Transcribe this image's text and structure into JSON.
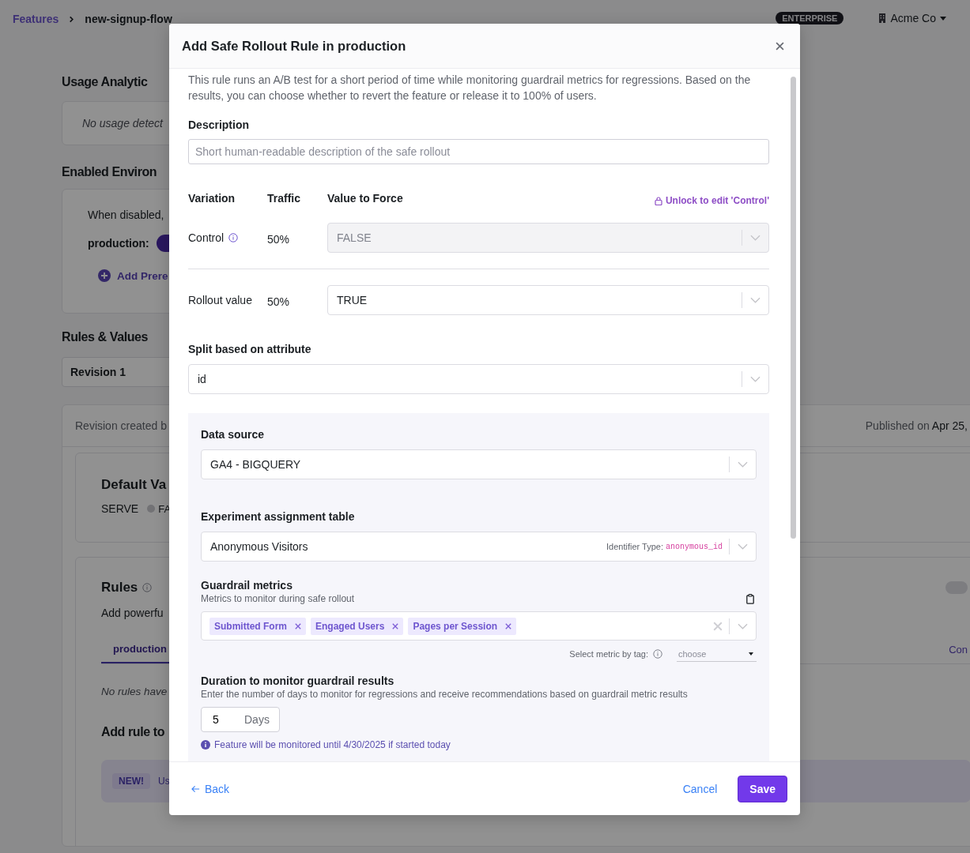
{
  "topbar": {
    "breadcrumb": [
      {
        "label": "Features",
        "kind": "link"
      },
      {
        "label": "new-signup-flow",
        "kind": "current"
      }
    ],
    "plan_badge": "ENTERPRISE",
    "org": "Acme Co"
  },
  "background": {
    "usage": {
      "title": "Usage Analytic",
      "message": "No usage detect"
    },
    "environments": {
      "title": "Enabled Environ",
      "note": "When disabled,",
      "env_label": "production:",
      "toggle_on": true,
      "add_link": "Add Prere"
    },
    "rules_values": {
      "title": "Rules & Values",
      "revision": "Revision 1",
      "created": "Revision created b",
      "published_label": "Published on",
      "published_date": "Apr 25,"
    },
    "default_value": {
      "title": "Default Va",
      "serve": "SERVE",
      "value": "FA"
    },
    "rules": {
      "title": "Rules",
      "description": "Add powerfu",
      "toggle_on": false,
      "tabs": [
        {
          "label": "production",
          "selected": true
        }
      ],
      "side_link": "Con",
      "empty": "No rules have",
      "add_title": "Add rule to",
      "banner_badge": "NEW!",
      "banner_text": "Us"
    }
  },
  "modal": {
    "title": "Add Safe Rollout Rule in production",
    "intro": "This rule runs an A/B test for a short period of time while monitoring guardrail metrics for regressions. Based on the results, you can choose whether to revert the feature or release it to 100% of users.",
    "description": {
      "label": "Description",
      "placeholder": "Short human-readable description of the safe rollout"
    },
    "variations": {
      "headers": [
        "Variation",
        "Traffic",
        "Value to Force"
      ],
      "unlock": "Unlock to edit 'Control'",
      "rows": [
        {
          "name": "Control",
          "info": true,
          "traffic": "50%",
          "value": "FALSE",
          "disabled": true
        },
        {
          "name": "Rollout value",
          "info": false,
          "traffic": "50%",
          "value": "TRUE",
          "disabled": false
        }
      ]
    },
    "split": {
      "label": "Split based on attribute",
      "value": "id"
    },
    "data_source": {
      "label": "Data source",
      "value": "GA4 - BIGQUERY"
    },
    "assignment": {
      "label": "Experiment assignment table",
      "value": "Anonymous Visitors",
      "identifier_label": "Identifier Type:",
      "identifier": "anonymous_id"
    },
    "guardrail": {
      "label": "Guardrail metrics",
      "hint": "Metrics to monitor during safe rollout",
      "tags": [
        "Submitted Form",
        "Engaged Users",
        "Pages per Session"
      ],
      "tag_filter_label": "Select metric by tag:",
      "tag_filter_placeholder": "choose"
    },
    "duration": {
      "label": "Duration to monitor guardrail results",
      "hint": "Enter the number of days to monitor for regressions and receive recommendations based on guardrail metric results",
      "value": "5",
      "unit": "Days",
      "note": "Feature will be monitored until 4/30/2025 if started today"
    },
    "footer": {
      "back": "Back",
      "cancel": "Cancel",
      "save": "Save"
    }
  }
}
